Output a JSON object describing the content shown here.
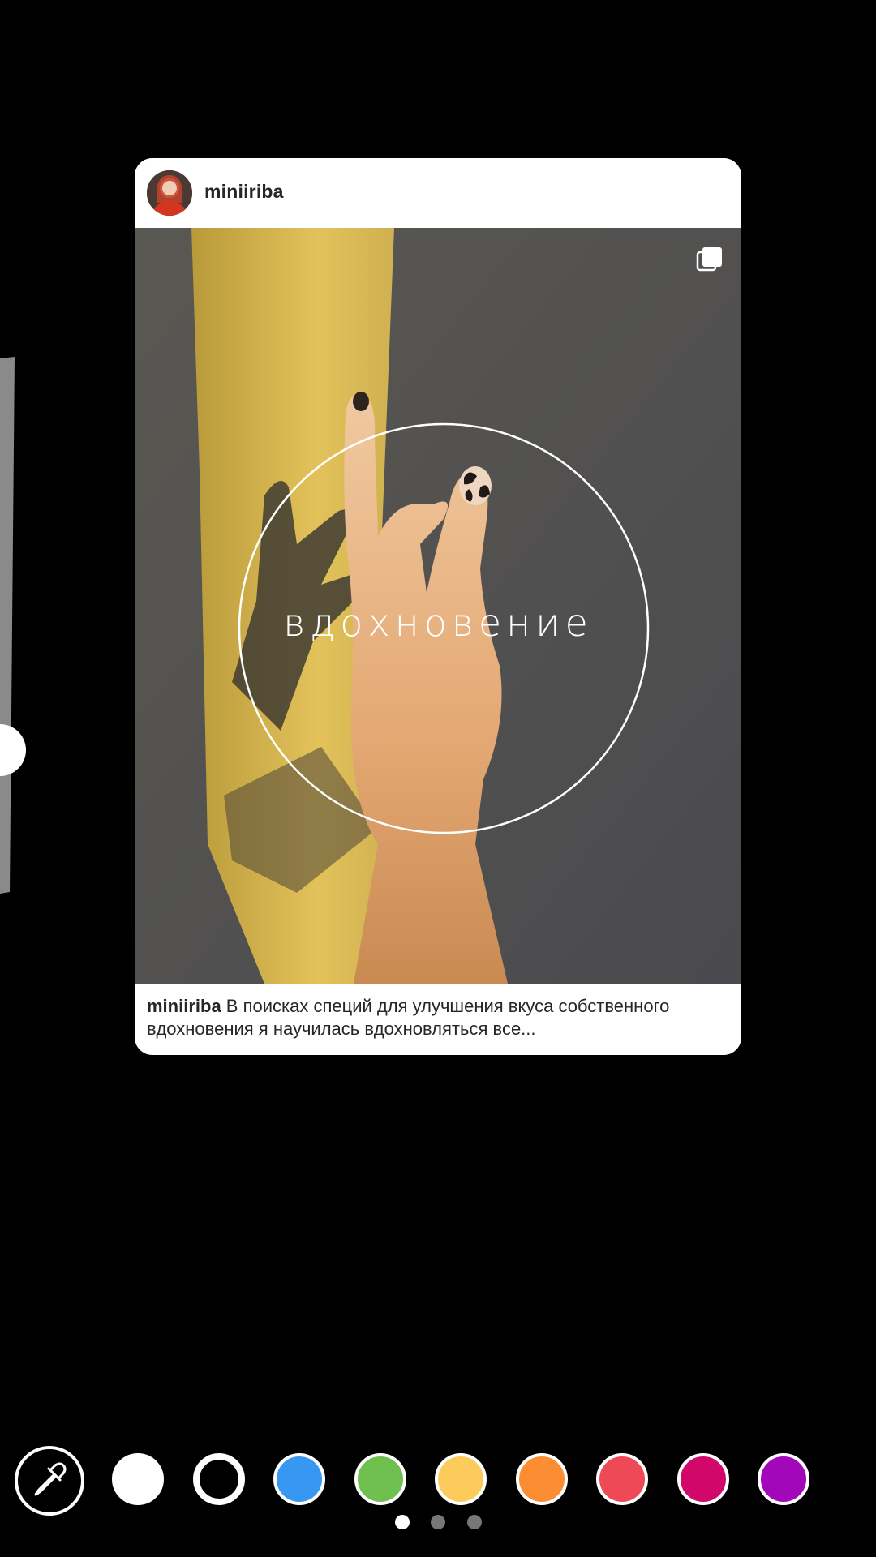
{
  "post": {
    "username": "miniiriba",
    "overlay_text": "вдохновение",
    "caption_user": "miniiriba",
    "caption_text": " В поисках специй для улучшения вкуса собственного вдохновения я научилась вдохновляться все..."
  },
  "icons": {
    "multi_photo": "carousel-icon",
    "eyedropper": "eyedropper-icon"
  },
  "palette": {
    "colors": [
      {
        "name": "white",
        "hex": "#FFFFFF"
      },
      {
        "name": "black",
        "hex": "#000000"
      },
      {
        "name": "blue",
        "hex": "#3897F0"
      },
      {
        "name": "green",
        "hex": "#70C050"
      },
      {
        "name": "yellow",
        "hex": "#FDCB5C"
      },
      {
        "name": "orange",
        "hex": "#FD8D32"
      },
      {
        "name": "red",
        "hex": "#ED4956"
      },
      {
        "name": "magenta",
        "hex": "#D10869"
      },
      {
        "name": "purple",
        "hex": "#A307BA"
      }
    ]
  },
  "pagination": {
    "pages": 3,
    "current": 1
  }
}
